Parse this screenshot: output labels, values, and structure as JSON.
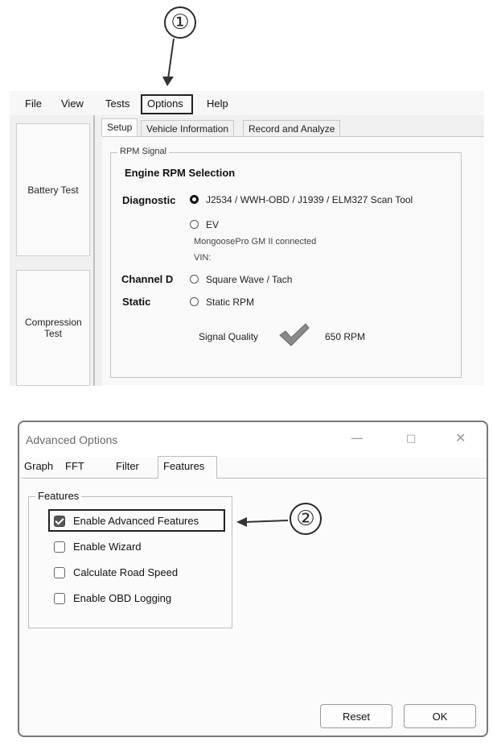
{
  "callouts": {
    "one": "①",
    "two": "②"
  },
  "menu": {
    "file": "File",
    "view": "View",
    "tests": "Tests",
    "options": "Options",
    "help": "Help"
  },
  "sidebar": {
    "battery": "Battery Test",
    "compression": "Compression Test"
  },
  "tabs": {
    "setup": "Setup",
    "vehicle_info": "Vehicle Information",
    "record_analyze": "Record and Analyze"
  },
  "rpm": {
    "group_title": "RPM Signal",
    "section_title": "Engine RPM Selection",
    "diagnostic_label": "Diagnostic",
    "option_j2534": "J2534 / WWH-OBD / J1939 / ELM327 Scan Tool",
    "option_ev": "EV",
    "connection_status": "MongoosePro GM II connected",
    "vin": "VIN:",
    "channel_label": "Channel D",
    "option_square": "Square Wave / Tach",
    "static_label": "Static",
    "option_static": "Static RPM",
    "signal_quality_label": "Signal Quality",
    "rpm_value": "650 RPM"
  },
  "dialog": {
    "title": "Advanced Options",
    "minimize": "—",
    "maximize": "□",
    "close": "✕",
    "tabs": {
      "graph": "Graph",
      "fft": "FFT",
      "filter": "Filter",
      "features": "Features"
    },
    "features_group": "Features",
    "options": [
      {
        "label": "Enable Advanced Features",
        "checked": true
      },
      {
        "label": "Enable Wizard",
        "checked": false
      },
      {
        "label": "Calculate Road Speed",
        "checked": false
      },
      {
        "label": "Enable OBD Logging",
        "checked": false
      }
    ],
    "reset": "Reset",
    "ok": "OK"
  }
}
